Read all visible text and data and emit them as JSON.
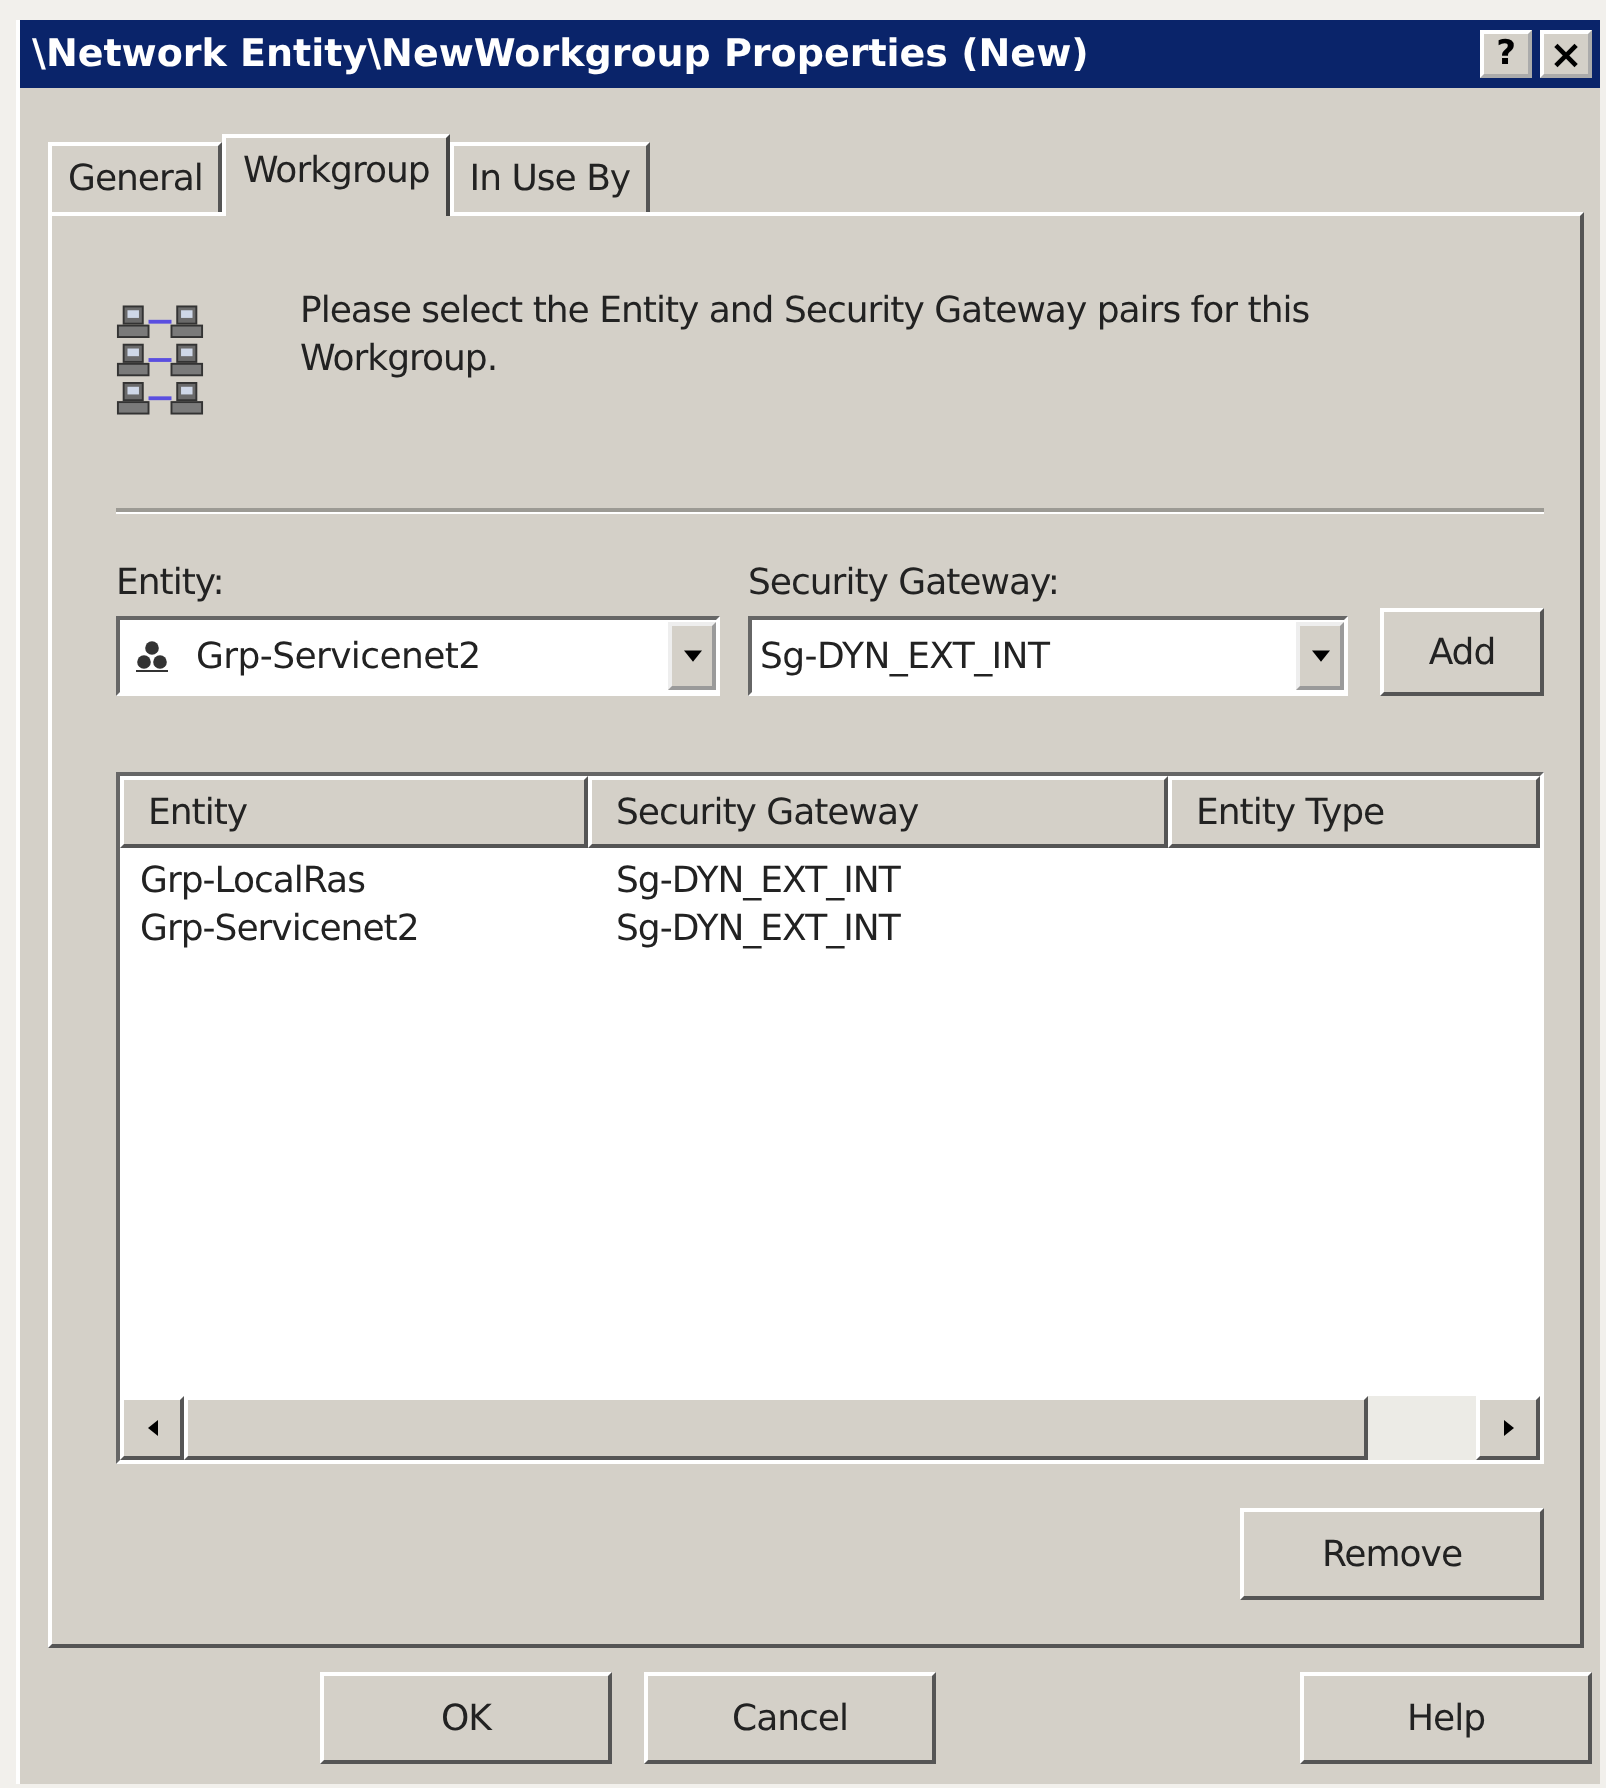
{
  "window": {
    "title": "\\Network Entity\\NewWorkgroup Properties (New)",
    "title_buttons": [
      {
        "kind": "help",
        "label": "?"
      },
      {
        "kind": "close",
        "label": "×"
      }
    ]
  },
  "tabs": [
    {
      "label": "General",
      "selected": false
    },
    {
      "label": "Workgroup",
      "selected": true
    },
    {
      "label": "In Use By",
      "selected": false
    }
  ],
  "description": "Please select the Entity and Security Gateway pairs for this Workgroup.",
  "entity": {
    "label": "Entity:",
    "value": "Grp-Servicenet2"
  },
  "security_gateway": {
    "label": "Security Gateway:",
    "value": "Sg-DYN_EXT_INT"
  },
  "add_button": "Add",
  "table": {
    "columns": [
      "Entity",
      "Security Gateway",
      "Entity Type"
    ],
    "rows": [
      [
        "Grp-LocalRas",
        "Sg-DYN_EXT_INT"
      ],
      [
        "Grp-Servicenet2",
        "Sg-DYN_EXT_INT"
      ]
    ]
  },
  "remove_button": "Remove",
  "buttons": [
    {
      "kind": "ok",
      "label": "OK"
    },
    {
      "kind": "cancel",
      "label": "Cancel"
    },
    {
      "kind": "help",
      "label": "Help"
    }
  ]
}
